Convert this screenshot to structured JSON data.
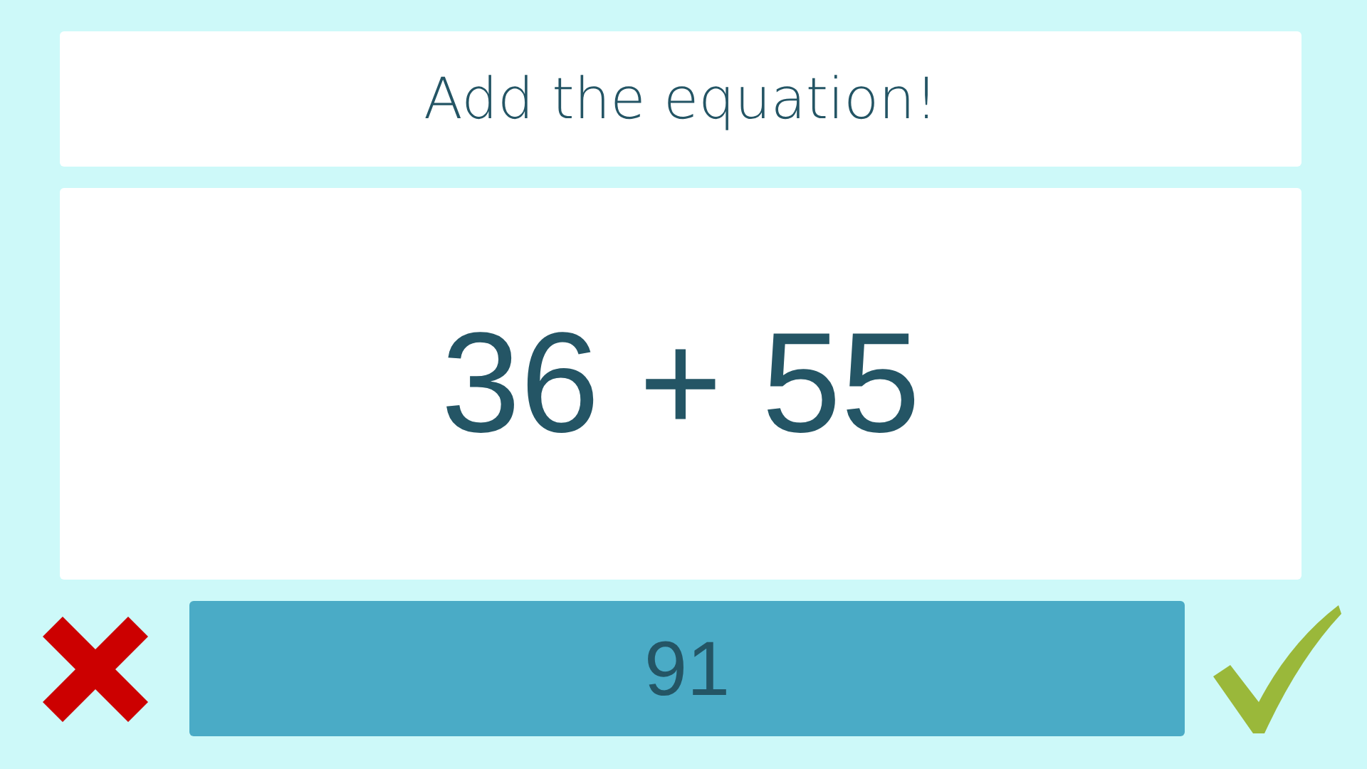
{
  "instruction": "Add the equation!",
  "equation": "36 + 55",
  "answer": {
    "value": "91"
  }
}
